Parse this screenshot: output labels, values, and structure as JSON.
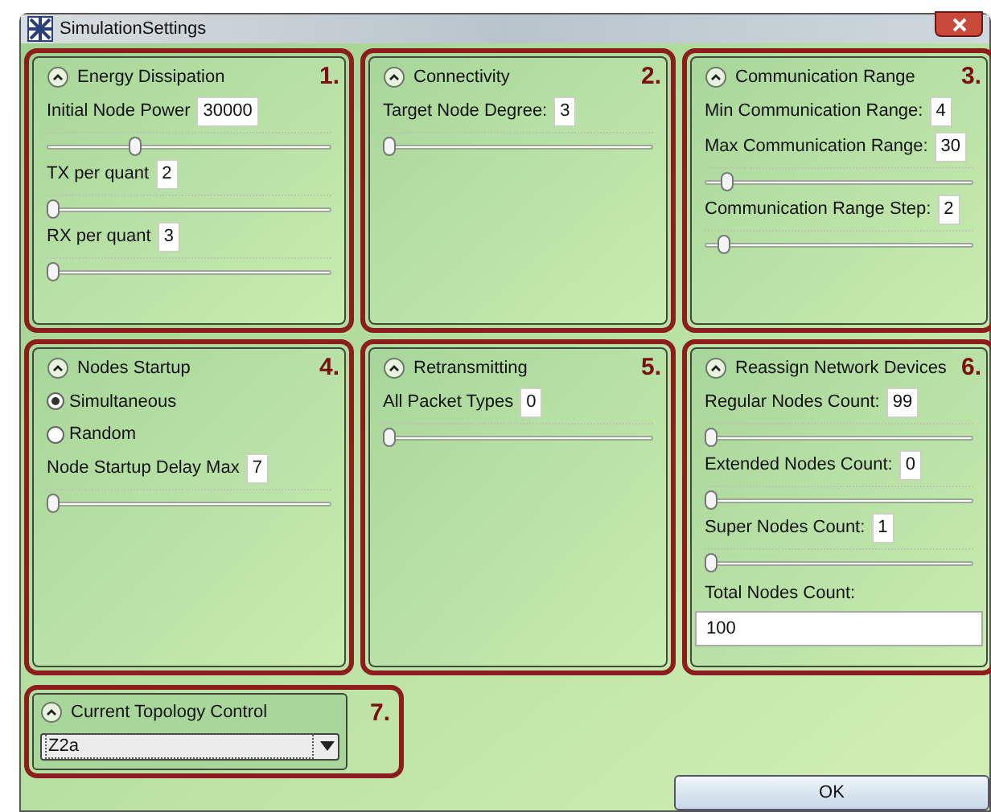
{
  "window": {
    "title": "SimulationSettings"
  },
  "panels": [
    {
      "number": "1.",
      "title": "Energy Dissipation",
      "controls": [
        {
          "kind": "slider",
          "label": "Initial Node Power",
          "value": "30000",
          "level": 0.3
        },
        {
          "kind": "slider",
          "label": "TX per quant",
          "value": "2",
          "level": 0
        },
        {
          "kind": "slider",
          "label": "RX per quant",
          "value": "3",
          "level": 0
        }
      ]
    },
    {
      "number": "2.",
      "title": "Connectivity",
      "controls": [
        {
          "kind": "slider",
          "label": "Target Node Degree:",
          "value": "3",
          "level": 0
        }
      ]
    },
    {
      "number": "3.",
      "title": "Communication Range",
      "controls": [
        {
          "kind": "field",
          "label": "Min Communication Range:",
          "value": "4"
        },
        {
          "kind": "slider",
          "label": "Max Communication Range:",
          "value": "30",
          "level": 0.06
        },
        {
          "kind": "slider",
          "label": "Communication Range Step:",
          "value": "2",
          "level": 0.05
        }
      ]
    },
    {
      "number": "4.",
      "title": "Nodes Startup",
      "controls": [
        {
          "kind": "radio",
          "label": "Simultaneous",
          "selected": true
        },
        {
          "kind": "radio",
          "label": "Random",
          "selected": false
        },
        {
          "kind": "slider",
          "label": "Node Startup Delay Max",
          "value": "7",
          "level": 0
        }
      ]
    },
    {
      "number": "5.",
      "title": "Retransmitting",
      "controls": [
        {
          "kind": "slider",
          "label": "All Packet Types",
          "value": "0",
          "level": 0
        }
      ]
    },
    {
      "number": "6.",
      "title": "Reassign Network Devices",
      "controls": [
        {
          "kind": "slider",
          "label": "Regular Nodes Count:",
          "value": "99",
          "level": 0
        },
        {
          "kind": "slider",
          "label": "Extended Nodes Count:",
          "value": "0",
          "level": 0
        },
        {
          "kind": "slider",
          "label": "Super Nodes Count:",
          "value": "1",
          "level": 0
        },
        {
          "kind": "block",
          "label": "Total Nodes Count:",
          "value": "100"
        }
      ]
    }
  ],
  "topology": {
    "number": "7.",
    "title": "Current Topology Control",
    "value": "Z2a"
  },
  "ok_button": "OK"
}
